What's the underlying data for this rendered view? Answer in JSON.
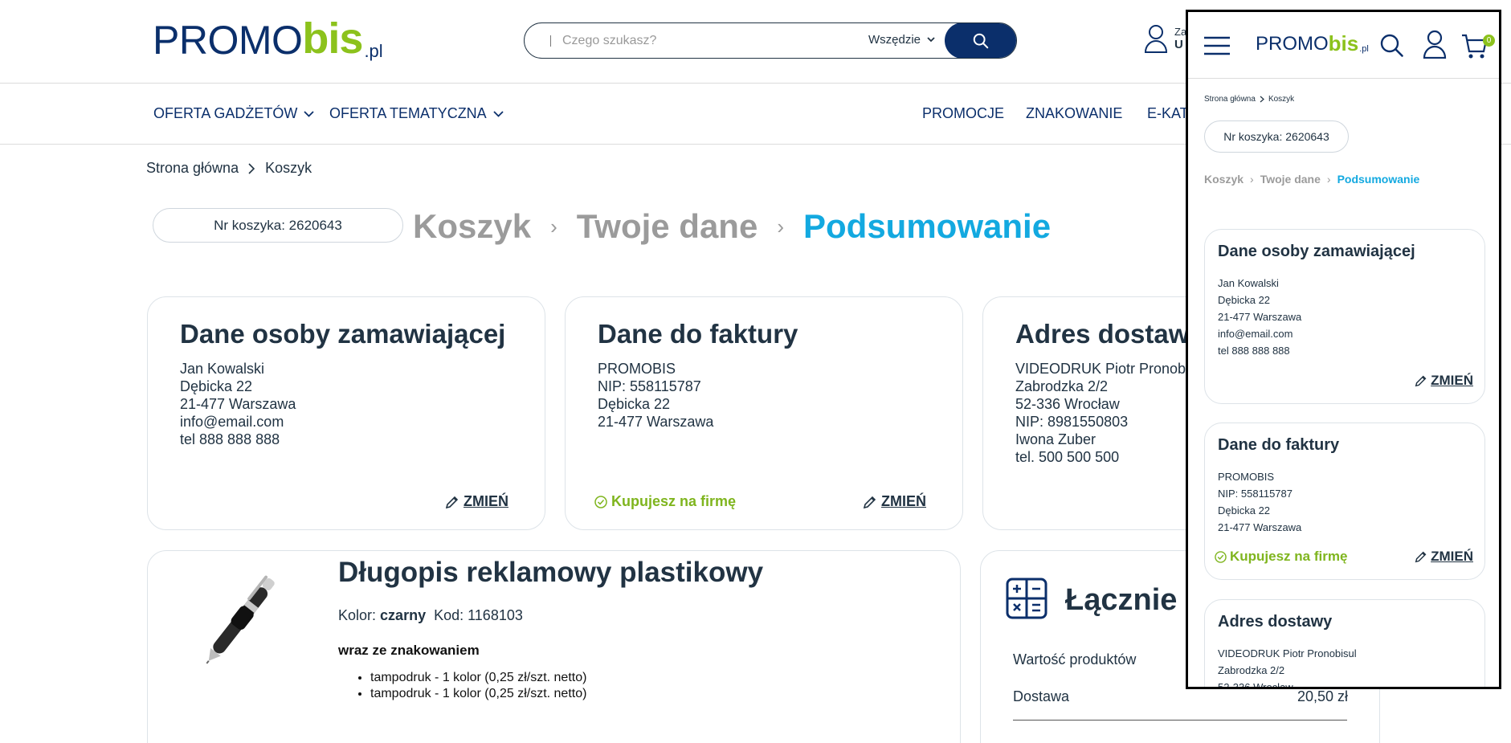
{
  "header": {
    "logo": {
      "promo": "PROMO",
      "bis": "bis",
      "pl": ".pl"
    },
    "search": {
      "placeholder": "Czego szukasz?",
      "scope": "Wszędzie"
    },
    "account": {
      "line1": "Za",
      "line2": "U"
    }
  },
  "nav": {
    "left": [
      "OFERTA GADŻETÓW",
      "OFERTA TEMATYCZNA"
    ],
    "right": [
      "PROMOCJE",
      "ZNAKOWANIE",
      "E-KAT"
    ]
  },
  "breadcrumb": {
    "home": "Strona główna",
    "current": "Koszyk"
  },
  "cart": {
    "number_label": "Nr koszyka: 2620643"
  },
  "steps": {
    "step1": "Koszyk",
    "step2": "Twoje dane",
    "step3": "Podsumowanie",
    "separator": "›"
  },
  "orderer": {
    "title": "Dane osoby zamawiającej",
    "name": "Jan Kowalski",
    "street": "Dębicka 22",
    "city": "21-477 Warszawa",
    "email": "info@email.com",
    "phone": "tel 888 888 888",
    "change": "ZMIEŃ"
  },
  "invoice": {
    "title": "Dane do faktury",
    "company": "PROMOBIS",
    "nip": "NIP: 558115787",
    "street": "Dębicka 22",
    "city": "21-477 Warszawa",
    "company_badge": "Kupujesz na firmę",
    "change": "ZMIEŃ"
  },
  "delivery": {
    "title": "Adres dostaw",
    "title_full": "Adres dostawy",
    "company": "VIDEODRUK Piotr Pronobis",
    "company_full": "VIDEODRUK Piotr Pronobisul",
    "street": "Zabrodzka 2/2",
    "city": "52-336 Wrocław",
    "city_mobile": "52-336 Wrocław",
    "nip": "NIP: 8981550803",
    "person": "Iwona Zuber",
    "phone": "tel. 500 500 500"
  },
  "product": {
    "title": "Długopis reklamowy plastikowy",
    "color_label": "Kolor:",
    "color_value": "czarny",
    "code_label": "Kod: 1168103",
    "with_marking": "wraz ze znakowaniem",
    "markings": [
      "tampodruk - 1 kolor (0,25 zł/szt. netto)",
      "tampodruk - 1 kolor (0,25 zł/szt. netto)"
    ]
  },
  "summary": {
    "title": "Łącznie",
    "products_label": "Wartość produktów",
    "shipping_label": "Dostawa",
    "shipping_value": "20,50 zł"
  },
  "mobile": {
    "cart_badge": "0",
    "breadcrumb_home": "Strona główna",
    "breadcrumb_current": "Koszyk"
  }
}
